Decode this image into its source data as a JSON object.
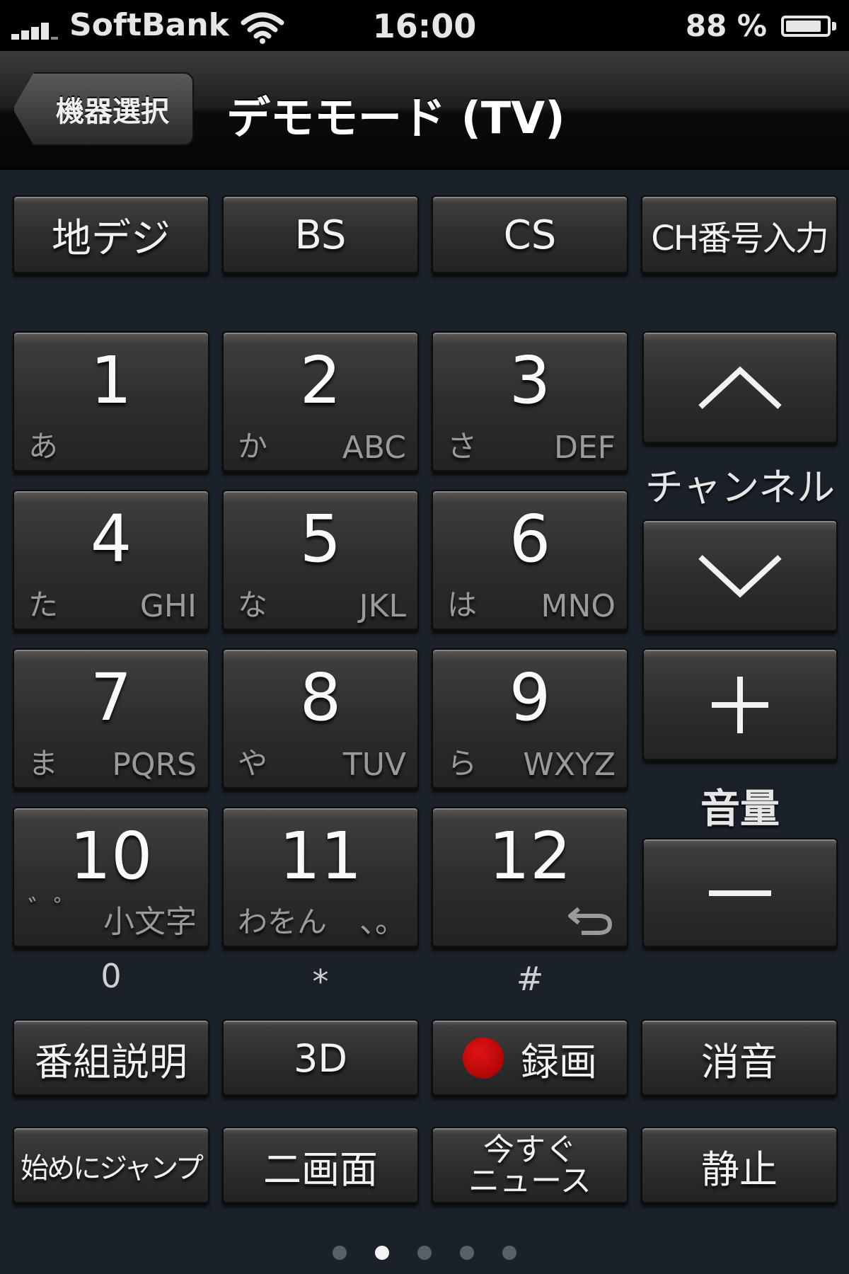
{
  "status_bar": {
    "carrier": "SoftBank",
    "time": "16:00",
    "battery": "88 %",
    "battery_level": 0.88
  },
  "nav": {
    "back_label": "機器選択",
    "title": "デモモード (TV)"
  },
  "sources": [
    {
      "label": "地デジ"
    },
    {
      "label": "BS"
    },
    {
      "label": "CS"
    },
    {
      "label": "CH番号入力"
    }
  ],
  "keypad": [
    {
      "num": "1",
      "kana": "あ",
      "alpha": ""
    },
    {
      "num": "2",
      "kana": "か",
      "alpha": "ABC"
    },
    {
      "num": "3",
      "kana": "さ",
      "alpha": "DEF"
    },
    {
      "num": "4",
      "kana": "た",
      "alpha": "GHI"
    },
    {
      "num": "5",
      "kana": "な",
      "alpha": "JKL"
    },
    {
      "num": "6",
      "kana": "は",
      "alpha": "MNO"
    },
    {
      "num": "7",
      "kana": "ま",
      "alpha": "PQRS"
    },
    {
      "num": "8",
      "kana": "や",
      "alpha": "TUV"
    },
    {
      "num": "9",
      "kana": "ら",
      "alpha": "WXYZ"
    },
    {
      "num": "10",
      "kana": "゛゜",
      "alpha": "小文字"
    },
    {
      "num": "11",
      "kana": "わをん",
      "alpha": "、。"
    },
    {
      "num": "12",
      "kana": "",
      "alpha": ""
    }
  ],
  "below_labels": [
    "0",
    "*",
    "#"
  ],
  "channel_label": "チャンネル",
  "volume_label": "音量",
  "volume_up": "+",
  "volume_down": "−",
  "function_row1": [
    {
      "label": "番組説明"
    },
    {
      "label": "3D"
    },
    {
      "label": "録画"
    },
    {
      "label": "消音"
    }
  ],
  "function_row2": [
    {
      "label": "始めにジャンプ"
    },
    {
      "label": "二画面"
    },
    {
      "label_line1": "今すぐ",
      "label_line2": "ニュース"
    },
    {
      "label": "静止"
    }
  ],
  "pager": {
    "pages": 5,
    "current": 2
  },
  "colors": {
    "record": "#cc0000",
    "background": "#1a2129"
  }
}
